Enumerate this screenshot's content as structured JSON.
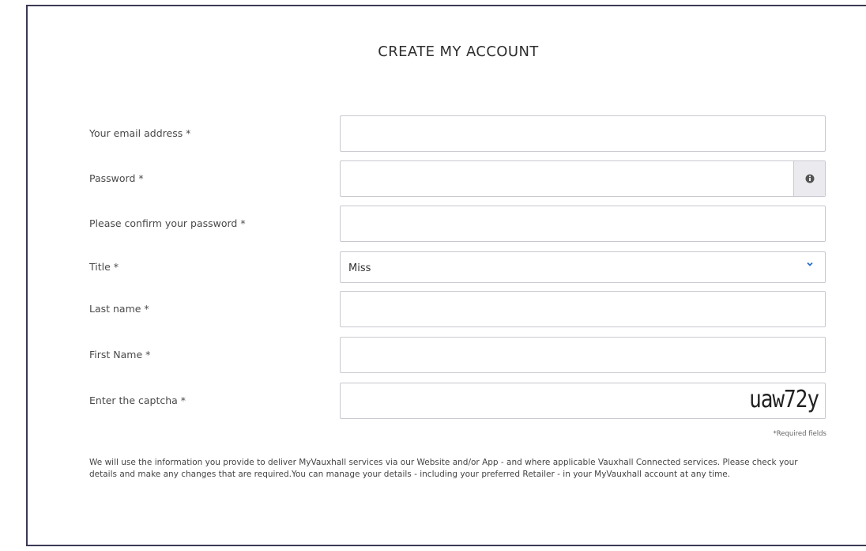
{
  "page": {
    "title": "CREATE MY ACCOUNT"
  },
  "form": {
    "email_label": "Your email address *",
    "email_value": "",
    "password_label": "Password *",
    "password_value": "",
    "password_info_icon": "info-circle-icon",
    "confirm_password_label": "Please confirm your password *",
    "confirm_password_value": "",
    "title_label": "Title *",
    "title_value": "Miss",
    "title_chevron_icon": "chevron-down-icon",
    "last_name_label": "Last name *",
    "last_name_value": "",
    "first_name_label": "First Name *",
    "first_name_value": "",
    "captcha_label": "Enter the captcha *",
    "captcha_value": "",
    "captcha_text": "uaw72y",
    "required_note": "*Required fields"
  },
  "footer": {
    "info_text": "We will use the information you provide to deliver MyVauxhall services via our Website and/or App - and where applicable Vauxhall Connected services. Please check your details and make any changes that are required.You can manage your details - including your preferred Retailer - in your MyVauxhall account at any time."
  },
  "colors": {
    "border": "#c8c8d0",
    "frame": "#3a3a55",
    "chevron": "#2a6fc9",
    "info_button_bg": "#ebebef"
  }
}
